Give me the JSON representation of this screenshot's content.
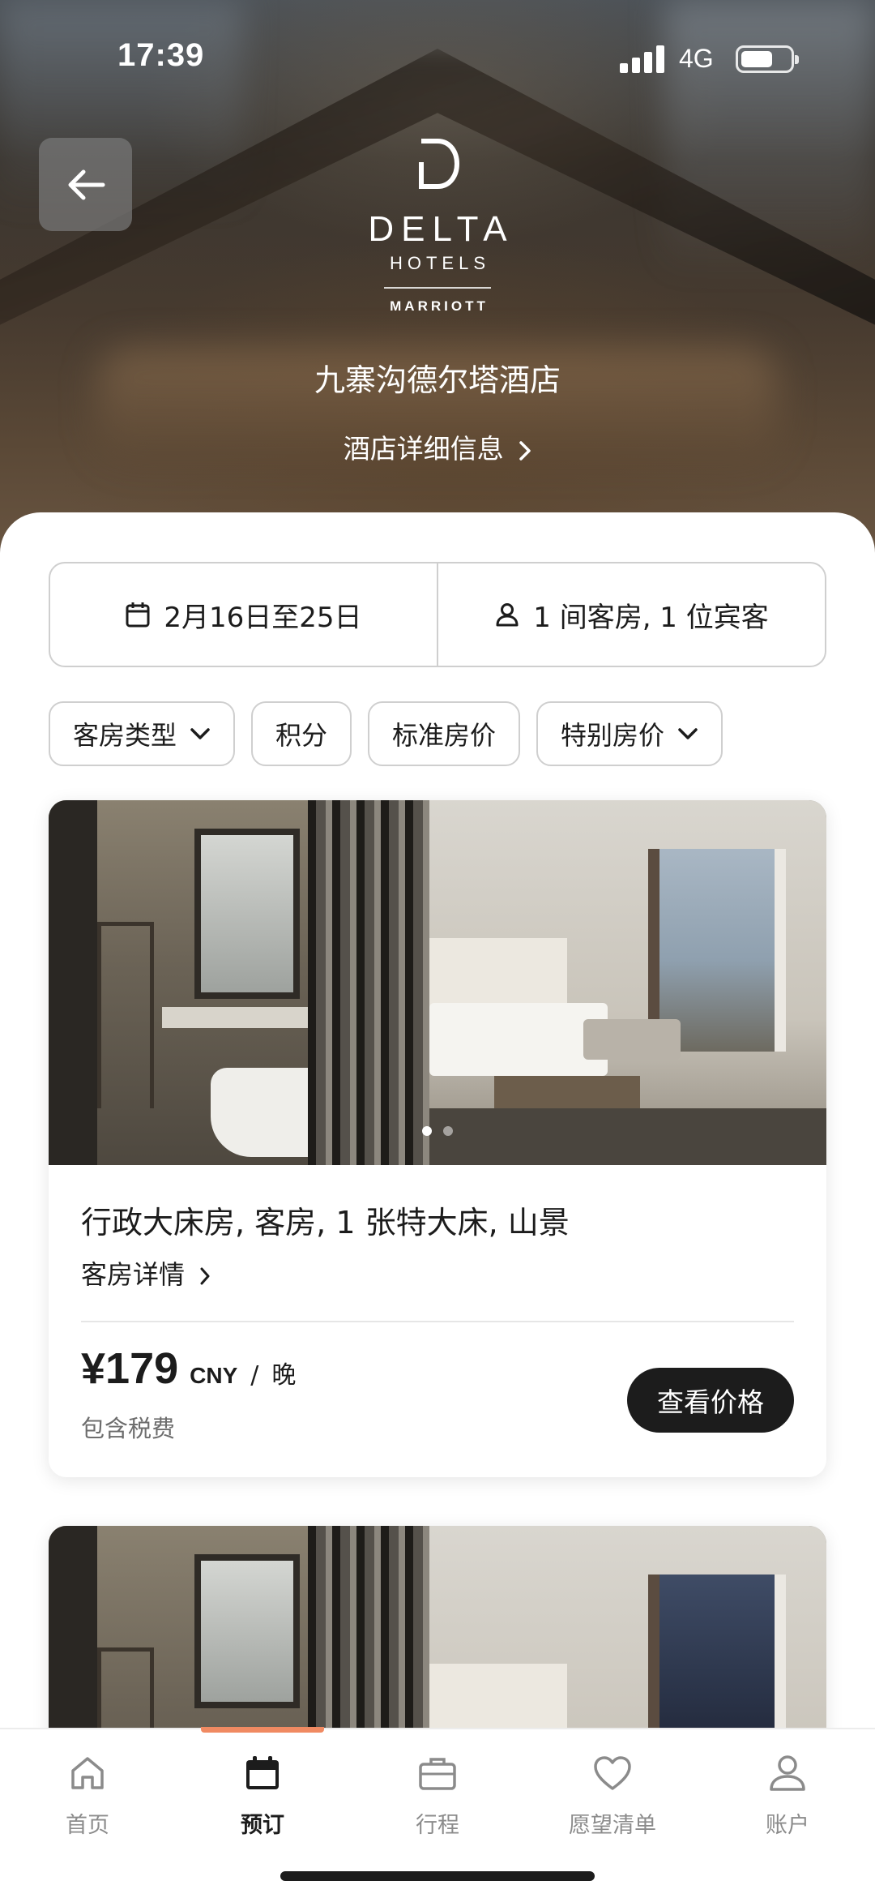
{
  "status_bar": {
    "time": "17:39",
    "network": "4G"
  },
  "brand": {
    "name": "DELTA",
    "sub": "HOTELS",
    "parent": "MARRIOTT"
  },
  "hotel": {
    "name": "九寨沟德尔塔酒店",
    "info_link": "酒店详细信息"
  },
  "search": {
    "dates": "2月16日至25日",
    "guests": "1 间客房, 1 位宾客"
  },
  "filters": [
    {
      "label": "客房类型",
      "has_dropdown": true
    },
    {
      "label": "积分",
      "has_dropdown": false
    },
    {
      "label": "标准房价",
      "has_dropdown": false
    },
    {
      "label": "特别房价",
      "has_dropdown": true
    }
  ],
  "rooms": [
    {
      "title": "行政大床房, 客房, 1 张特大床, 山景",
      "details_link": "客房详情",
      "price": "¥179",
      "currency": "CNY",
      "per": "晚",
      "tax_note": "包含税费",
      "cta": "查看价格",
      "photo_count": 2,
      "photo_index": 1
    }
  ],
  "tabs": [
    {
      "label": "首页",
      "icon": "home-icon",
      "active": false
    },
    {
      "label": "预订",
      "icon": "calendar-icon",
      "active": true
    },
    {
      "label": "行程",
      "icon": "briefcase-icon",
      "active": false
    },
    {
      "label": "愿望清单",
      "icon": "heart-icon",
      "active": false
    },
    {
      "label": "账户",
      "icon": "person-icon",
      "active": false
    }
  ],
  "colors": {
    "accent": "#f08a62",
    "primary": "#1c1c1c",
    "muted": "#8b8b8b"
  }
}
